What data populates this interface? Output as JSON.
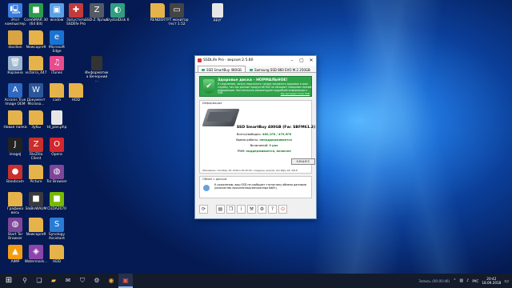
{
  "desktop_icons": [
    {
      "label": "Этот компьютер",
      "icon": "computer-icon",
      "color": "#3b7ddd"
    },
    {
      "label": "CoreSMAR 30 (64 Bit)",
      "icon": "app-icon",
      "color": "#2a9d4a"
    },
    {
      "label": "window",
      "icon": "window-icon",
      "color": "#5aa0e6"
    },
    {
      "label": "Запустить SSDlife Pro",
      "icon": "ssdlife-icon",
      "color": "#c43a3a"
    },
    {
      "label": "SSD-Z Ярлык",
      "icon": "ssdz-icon",
      "color": "#555a63"
    },
    {
      "label": "CrystalDisk 6",
      "icon": "crystaldisk-icon",
      "color": "#2f9f7f"
    },
    {
      "label": "RENDER",
      "icon": "folder-icon",
      "color": "#e6b34a"
    },
    {
      "label": "TFT монитор тест 1.52",
      "icon": "monitor-icon",
      "color": "#444"
    },
    {
      "label": "друг",
      "icon": "file-icon",
      "color": "#e6e6e6"
    },
    {
      "label": "davilion",
      "icon": "user-folder-icon",
      "color": "#d9a441"
    },
    {
      "label": "Newcapre9",
      "icon": "folder-icon",
      "color": "#e6b34a"
    },
    {
      "label": "Microsoft Edge",
      "icon": "edge-icon",
      "color": "#1a73d1"
    },
    {
      "label": "Корзина",
      "icon": "recycle-bin-icon",
      "color": "#9db4cf"
    },
    {
      "label": "victoria_447",
      "icon": "folder-icon",
      "color": "#e6b34a"
    },
    {
      "label": "iTunes",
      "icon": "itunes-icon",
      "color": "#e84c8c"
    },
    {
      "label": "Информатика Вечерний ...",
      "icon": "document-icon",
      "color": "#333"
    },
    {
      "label": "Acronis True Image OEM",
      "icon": "acronis-icon",
      "color": "#2e68c0"
    },
    {
      "label": "Документ Microso...",
      "icon": "word-icon",
      "color": "#2b579a"
    },
    {
      "label": "cash",
      "icon": "folder-icon",
      "color": "#e6b34a"
    },
    {
      "label": "HDD",
      "icon": "folder-icon",
      "color": "#e6b34a"
    },
    {
      "label": "Новая папка",
      "icon": "folder-icon",
      "color": "#e6b34a"
    },
    {
      "label": "Зубы",
      "icon": "folder-icon",
      "color": "#e6b34a"
    },
    {
      "label": "td_pan.php",
      "icon": "file-icon",
      "color": "#e6e6e6"
    },
    {
      "label": "imageJ",
      "icon": "imagej-icon",
      "color": "#222"
    },
    {
      "label": "FileZilla Client",
      "icon": "filezilla-icon",
      "color": "#c9302c"
    },
    {
      "label": "Opera",
      "icon": "opera-icon",
      "color": "#d3262e"
    },
    {
      "label": "Bandicam",
      "icon": "bandicam-icon",
      "color": "#c9302c"
    },
    {
      "label": "Picture",
      "icon": "folder-icon",
      "color": "#e6b34a"
    },
    {
      "label": "Tor Browser",
      "icon": "tor-icon",
      "color": "#7d4698"
    },
    {
      "label": "Графика весь",
      "icon": "folder-icon",
      "color": "#e6b34a"
    },
    {
      "label": "SloBnWAUM",
      "icon": "app-icon",
      "color": "#3b3b3b"
    },
    {
      "label": "CUDA2070",
      "icon": "app-icon",
      "color": "#76b900"
    },
    {
      "label": "Start Tor Browser",
      "icon": "tor-icon",
      "color": "#7d4698"
    },
    {
      "label": "Newcapre9",
      "icon": "folder-icon",
      "color": "#e6b34a"
    },
    {
      "label": "Synology Assistant",
      "icon": "synology-icon",
      "color": "#2a7bd4"
    },
    {
      "label": "AIMP",
      "icon": "aimp-icon",
      "color": "#f39c12"
    },
    {
      "label": "Watermark...",
      "icon": "watermark-icon",
      "color": "#8e44ad"
    },
    {
      "label": "HDD",
      "icon": "folder-icon",
      "color": "#e6b34a"
    }
  ],
  "window": {
    "title": "SSDLife Pro - версия 2.5.80",
    "tabs": [
      "SSD SmartBuy 480GB",
      "Samsung SSD 860 EVO M.2 250GB"
    ],
    "health": {
      "title": "Здоровье диска - НОРМАЛЬНОЕ!",
      "text": "К сожалению, запуск подсчитать тупики заключать здоровье и срок службы, так как данные продуктой SSD не обладает неверным полной информации. Настоятельно рекомендуем подробной информации о SSD.",
      "link": "Как выглядит отчет SSD"
    },
    "info": {
      "header": "Информация",
      "model": "SSD SmartBuy 480GB (Fw: SBFM61.2)",
      "capacity_label": "Всего/свободно:",
      "capacity_value": "480,1Гб / 479,9Гб",
      "uptime_label": "Время работы:",
      "uptime_value": "неподдерживается",
      "power_label": "Включений:",
      "power_value": "9 раз",
      "trim_label": "TRIM:",
      "trim_value": "поддерживается, включен",
      "smart_button": "S.M.A.R.T.",
      "footer": "Обновлено: Октябрь 18, 2018 в 20:42:00, следующ. анализ: Октябрь 18, 2018"
    },
    "share": {
      "header": "Обмен с диском",
      "text": "К сожалению, ваш SSD не сообщает статистику обмена данными (количество прочитанных/записанных байт)."
    },
    "toolbar_icons": [
      "refresh-icon",
      "report-icon",
      "copy-icon",
      "info-icon",
      "tools-icon",
      "settings-icon",
      "help-icon",
      "close-app-icon"
    ]
  },
  "taskbar": {
    "start_icon": "windows-icon",
    "items": [
      "search-icon",
      "task-view-icon",
      "explorer-icon",
      "mail-icon",
      "store-icon",
      "settings-icon",
      "chrome-icon",
      "ssdlife-icon"
    ],
    "tray_text": "Запись (00:00:46)",
    "lang": "РУС",
    "time": "20:42",
    "date": "18.09.2018"
  },
  "colors": {
    "accent": "#2fa44a",
    "taskbar": "#141b2b",
    "window_border": "#6a8fbf"
  }
}
